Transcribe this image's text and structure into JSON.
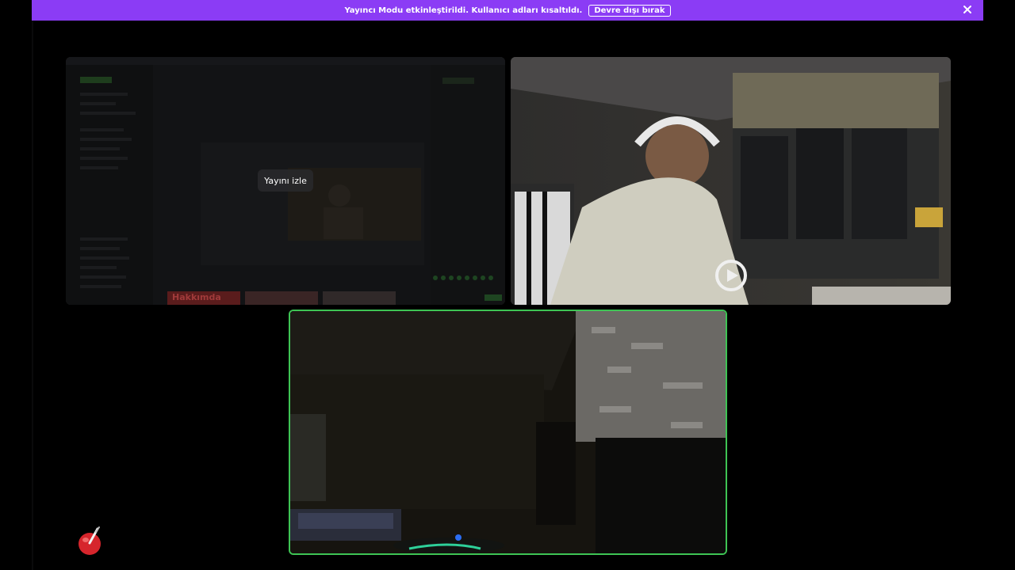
{
  "banner": {
    "message": "Yayıncı Modu etkinleştirildi. Kullanıcı adları kısaltıldı.",
    "disable_label": "Devre dışı bırak",
    "close_icon": "close-icon",
    "color": "#8b3cf5"
  },
  "streams": {
    "screen_share": {
      "watch_label": "Yayını izle",
      "overlay_text": "Hakkımda"
    },
    "camera_1": {
      "icon": "elgato-icon"
    },
    "camera_2": {
      "speaking_border_color": "#3ec454"
    }
  },
  "app_icon": "app-logo-icon"
}
